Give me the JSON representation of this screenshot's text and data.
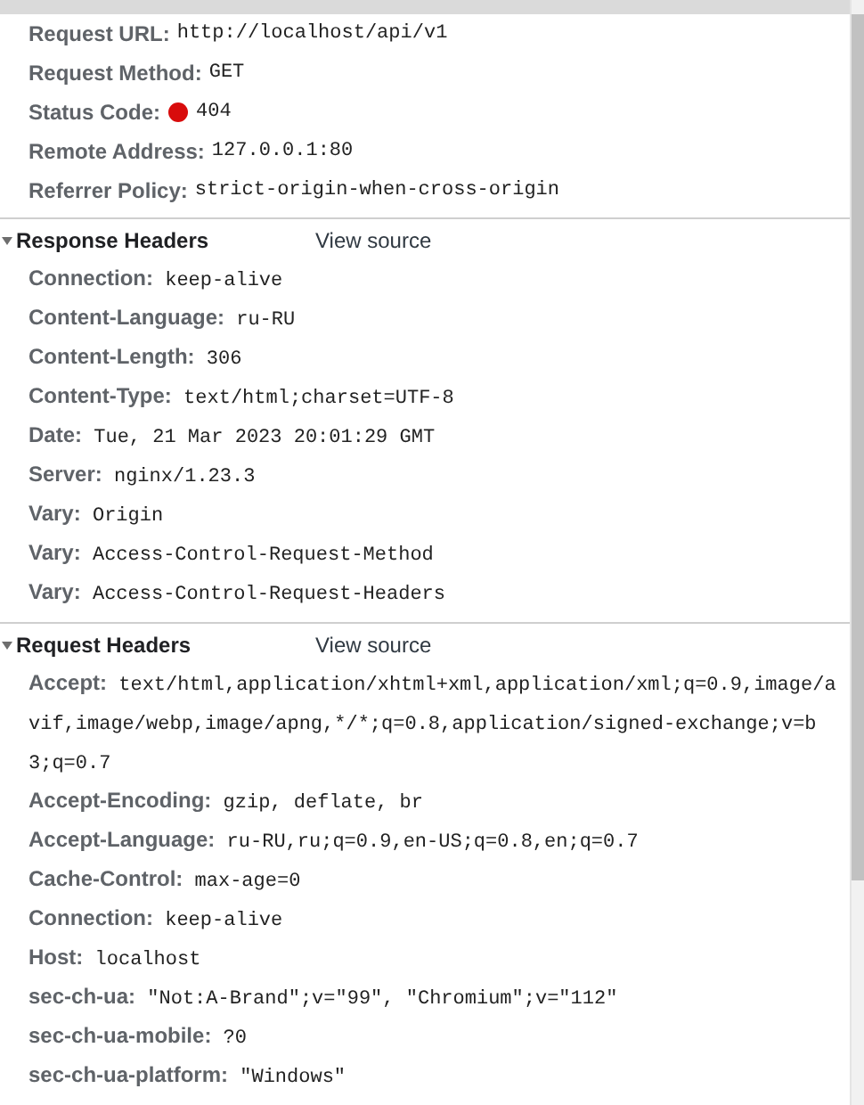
{
  "general": [
    {
      "kind": "plain",
      "name": "Request URL:",
      "value": "http://localhost/api/v1"
    },
    {
      "kind": "plain",
      "name": "Request Method:",
      "value": "GET"
    },
    {
      "kind": "status",
      "name": "Status Code:",
      "value": "404"
    },
    {
      "kind": "plain",
      "name": "Remote Address:",
      "value": "127.0.0.1:80"
    },
    {
      "kind": "plain",
      "name": "Referrer Policy:",
      "value": "strict-origin-when-cross-origin"
    }
  ],
  "sections": [
    {
      "title": "Response Headers",
      "expanded": true,
      "link": "View source",
      "headers": [
        {
          "name": "Connection:",
          "value": "keep-alive"
        },
        {
          "name": "Content-Language:",
          "value": "ru-RU"
        },
        {
          "name": "Content-Length:",
          "value": "306"
        },
        {
          "name": "Content-Type:",
          "value": "text/html;charset=UTF-8"
        },
        {
          "name": "Date:",
          "value": "Tue, 21 Mar 2023 20:01:29 GMT"
        },
        {
          "name": "Server:",
          "value": "nginx/1.23.3"
        },
        {
          "name": "Vary:",
          "value": "Origin"
        },
        {
          "name": "Vary:",
          "value": "Access-Control-Request-Method"
        },
        {
          "name": "Vary:",
          "value": "Access-Control-Request-Headers"
        }
      ]
    },
    {
      "title": "Request Headers",
      "expanded": true,
      "link": "View source",
      "headers": [
        {
          "name": "Accept:",
          "value": "text/html,application/xhtml+xml,application/xml;q=0.9,image/avif,image/webp,image/apng,*/*;q=0.8,application/signed-exchange;v=b3;q=0.7"
        },
        {
          "name": "Accept-Encoding:",
          "value": "gzip, deflate, br"
        },
        {
          "name": "Accept-Language:",
          "value": "ru-RU,ru;q=0.9,en-US;q=0.8,en;q=0.7"
        },
        {
          "name": "Cache-Control:",
          "value": "max-age=0"
        },
        {
          "name": "Connection:",
          "value": "keep-alive"
        },
        {
          "name": "Host:",
          "value": "localhost"
        },
        {
          "name": "sec-ch-ua:",
          "value": "\"Not:A-Brand\";v=\"99\", \"Chromium\";v=\"112\""
        },
        {
          "name": "sec-ch-ua-mobile:",
          "value": "?0"
        },
        {
          "name": "sec-ch-ua-platform:",
          "value": "\"Windows\""
        }
      ]
    }
  ]
}
